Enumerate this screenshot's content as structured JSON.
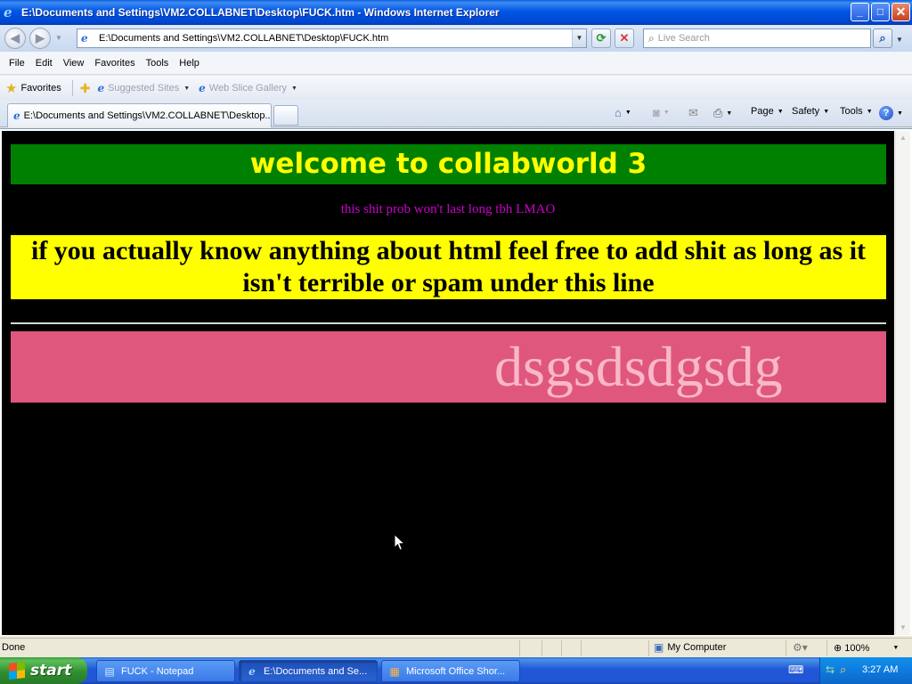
{
  "window": {
    "title": "E:\\Documents and Settings\\VM2.COLLABNET\\Desktop\\FUCK.htm - Windows Internet Explorer",
    "minimize_glyph": "_",
    "maximize_glyph": "□",
    "close_glyph": "✕"
  },
  "address_bar": {
    "url": "E:\\Documents and Settings\\VM2.COLLABNET\\Desktop\\FUCK.htm",
    "search_placeholder": "Live Search"
  },
  "menu": {
    "items": [
      "File",
      "Edit",
      "View",
      "Favorites",
      "Tools",
      "Help"
    ]
  },
  "favorites_bar": {
    "favorites_label": "Favorites",
    "links": [
      "Suggested Sites",
      "Web Slice Gallery"
    ]
  },
  "tabs": {
    "active_tab_title": "E:\\Documents and Settings\\VM2.COLLABNET\\Desktop..."
  },
  "command_bar": {
    "page_label": "Page",
    "safety_label": "Safety",
    "tools_label": "Tools"
  },
  "page": {
    "background_color": "#000000",
    "heading": "welcome to collabworld 3",
    "heading_bg": "#008000",
    "heading_color": "#ffff00",
    "subline": "this shit prob won't last long tbh LMAO",
    "subline_color": "#cc00cc",
    "yellow_block_text": "if you actually know anything about html feel free to add shit as long as it isn't terrible or spam under this line",
    "yellow_block_bg": "#ffff00",
    "marquee_text": "dsgsdsdgsdg",
    "pink_block_bg": "#e0577d"
  },
  "status_bar": {
    "status_text": "Done",
    "zone": "My Computer",
    "zoom": "100%"
  },
  "taskbar": {
    "start_label": "start",
    "buttons": [
      {
        "label": "FUCK - Notepad",
        "icon": "notepad-icon"
      },
      {
        "label": "E:\\Documents and Se...",
        "icon": "ie-icon",
        "active": true
      },
      {
        "label": "Microsoft Office Shor...",
        "icon": "office-icon"
      }
    ],
    "clock": "3:27 AM"
  }
}
